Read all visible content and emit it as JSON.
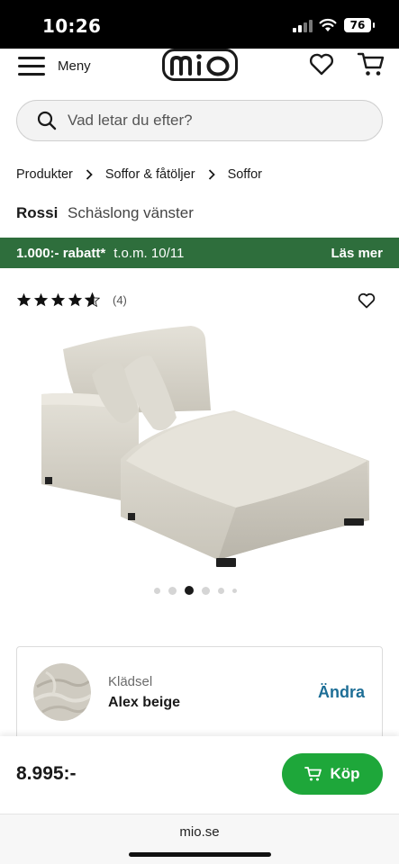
{
  "status_bar": {
    "time": "10:26",
    "battery": "76"
  },
  "header": {
    "menu_label": "Meny",
    "logo_text": "mio"
  },
  "search": {
    "placeholder": "Vad letar du efter?"
  },
  "breadcrumb": [
    "Produkter",
    "Soffor & fåtöljer",
    "Soffor"
  ],
  "product": {
    "brand": "Rossi",
    "name": "Schäslong vänster",
    "rating_stars": 4.5,
    "review_count": "(4)"
  },
  "promo": {
    "discount": "1.000:- rabatt*",
    "valid_until": "t.o.m. 10/11",
    "link": "Läs mer"
  },
  "carousel": {
    "total": 6,
    "active_index": 2
  },
  "option": {
    "label": "Klädsel",
    "value": "Alex beige",
    "change": "Ändra"
  },
  "buy": {
    "price": "8.995:-",
    "button": "Köp"
  },
  "browser": {
    "url": "mio.se"
  },
  "colors": {
    "promo_bg": "#2e6e3c",
    "buy_button": "#1ea73a",
    "link_blue": "#1d6e96",
    "fabric": "#d8d5cc"
  },
  "icons": [
    "hamburger-icon",
    "heart-icon",
    "cart-icon",
    "search-icon",
    "chevron-right-icon",
    "star-icon",
    "cart-icon"
  ]
}
